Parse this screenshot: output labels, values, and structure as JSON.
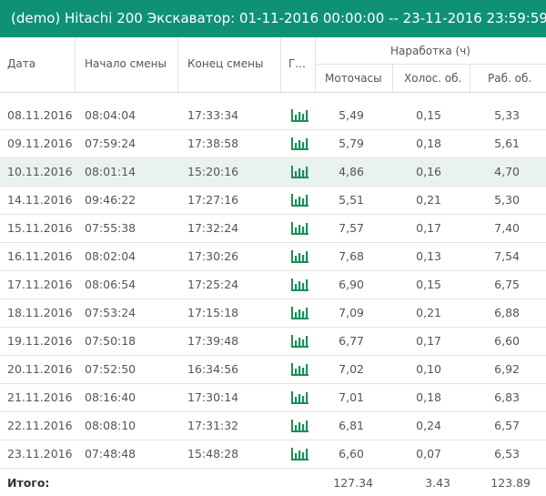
{
  "title": "(demo) Hitachi 200 Экскаватор: 01-11-2016 00:00:00 -- 23-11-2016 23:59:59",
  "header": {
    "date": "Дата",
    "start": "Начало смены",
    "end": "Конец смены",
    "chart": "Г...",
    "group": "Наработка (ч)",
    "moto": "Моточасы",
    "idle": "Холос. об.",
    "work": "Раб. об."
  },
  "accent_color": "#0f9178",
  "icon_color": "#1a8f5a",
  "rows": [
    {
      "date": "08.11.2016",
      "start": "08:04:04",
      "end": "17:33:34",
      "moto": "5,49",
      "idle": "0,15",
      "work": "5,33",
      "chart_icon": "bar-chart-icon"
    },
    {
      "date": "09.11.2016",
      "start": "07:59:24",
      "end": "17:38:58",
      "moto": "5,79",
      "idle": "0,18",
      "work": "5,61",
      "chart_icon": "bar-chart-icon"
    },
    {
      "date": "10.11.2016",
      "start": "08:01:14",
      "end": "15:20:16",
      "moto": "4,86",
      "idle": "0,16",
      "work": "4,70",
      "chart_icon": "bar-chart-icon"
    },
    {
      "date": "14.11.2016",
      "start": "09:46:22",
      "end": "17:27:16",
      "moto": "5,51",
      "idle": "0,21",
      "work": "5,30",
      "chart_icon": "bar-chart-icon"
    },
    {
      "date": "15.11.2016",
      "start": "07:55:38",
      "end": "17:32:24",
      "moto": "7,57",
      "idle": "0,17",
      "work": "7,40",
      "chart_icon": "bar-chart-icon"
    },
    {
      "date": "16.11.2016",
      "start": "08:02:04",
      "end": "17:30:26",
      "moto": "7,68",
      "idle": "0,13",
      "work": "7,54",
      "chart_icon": "bar-chart-icon"
    },
    {
      "date": "17.11.2016",
      "start": "08:06:54",
      "end": "17:25:24",
      "moto": "6,90",
      "idle": "0,15",
      "work": "6,75",
      "chart_icon": "bar-chart-icon"
    },
    {
      "date": "18.11.2016",
      "start": "07:53:24",
      "end": "17:15:18",
      "moto": "7,09",
      "idle": "0,21",
      "work": "6,88",
      "chart_icon": "bar-chart-icon"
    },
    {
      "date": "19.11.2016",
      "start": "07:50:18",
      "end": "17:39:48",
      "moto": "6,77",
      "idle": "0,17",
      "work": "6,60",
      "chart_icon": "bar-chart-icon"
    },
    {
      "date": "20.11.2016",
      "start": "07:52:50",
      "end": "16:34:56",
      "moto": "7,02",
      "idle": "0,10",
      "work": "6,92",
      "chart_icon": "bar-chart-icon"
    },
    {
      "date": "21.11.2016",
      "start": "08:16:40",
      "end": "17:30:14",
      "moto": "7,01",
      "idle": "0,18",
      "work": "6,83",
      "chart_icon": "bar-chart-icon"
    },
    {
      "date": "22.11.2016",
      "start": "08:08:10",
      "end": "17:31:32",
      "moto": "6,81",
      "idle": "0,24",
      "work": "6,57",
      "chart_icon": "bar-chart-icon"
    },
    {
      "date": "23.11.2016",
      "start": "07:48:48",
      "end": "15:48:28",
      "moto": "6,60",
      "idle": "0,07",
      "work": "6,53",
      "chart_icon": "bar-chart-icon"
    }
  ],
  "total": {
    "label": "Итого:",
    "moto": "127.34",
    "idle": "3.43",
    "work": "123.89"
  }
}
